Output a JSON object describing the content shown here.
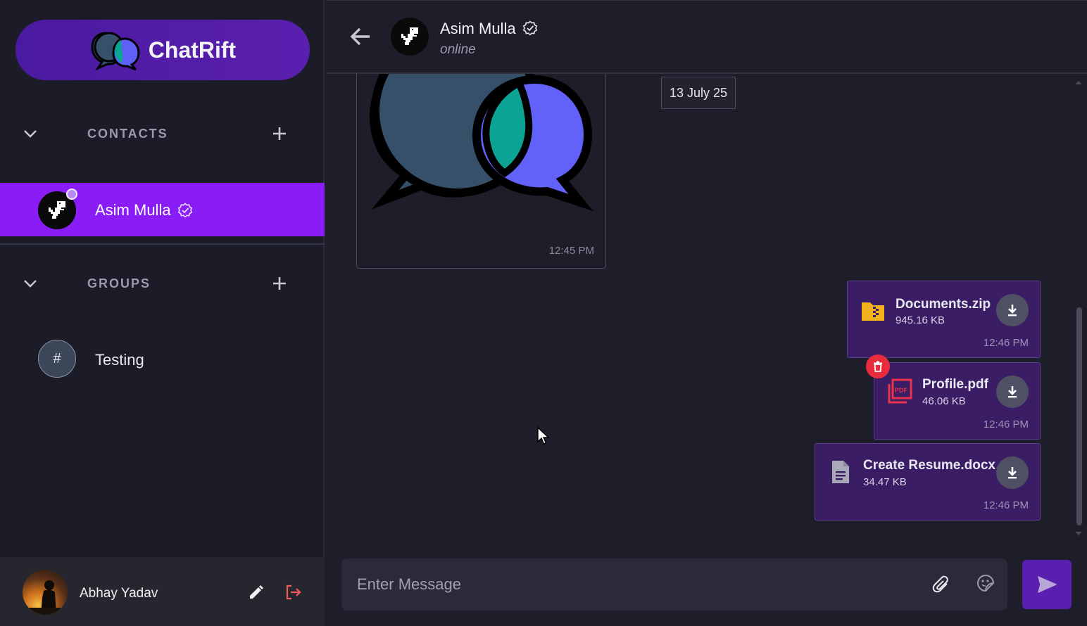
{
  "brand": {
    "name": "ChatRift"
  },
  "sidebar": {
    "contacts_label": "CONTACTS",
    "groups_label": "GROUPS",
    "contacts": [
      {
        "name": "Asim Mulla",
        "verified": true,
        "online": true
      }
    ],
    "groups": [
      {
        "symbol": "#",
        "name": "Testing"
      }
    ]
  },
  "me": {
    "name": "Abhay Yadav"
  },
  "chat": {
    "contact_name": "Asim Mulla",
    "status": "online",
    "date_chip": "13 July 25",
    "image_message": {
      "time": "12:45 PM"
    },
    "files": [
      {
        "name": "Documents.zip",
        "size": "945.16 KB",
        "time": "12:46 PM",
        "icon": "zip-folder-icon"
      },
      {
        "name": "Profile.pdf",
        "size": "46.06 KB",
        "time": "12:46 PM",
        "icon": "pdf-icon"
      },
      {
        "name": "Create Resume.docx",
        "size": "34.47 KB",
        "time": "12:46 PM",
        "icon": "document-icon"
      }
    ]
  },
  "composer": {
    "placeholder": "Enter Message"
  },
  "colors": {
    "accent": "#8a1cf6",
    "brand": "#5a1fae",
    "file_bubble": "#3b1d66",
    "danger": "#e82c3c"
  }
}
